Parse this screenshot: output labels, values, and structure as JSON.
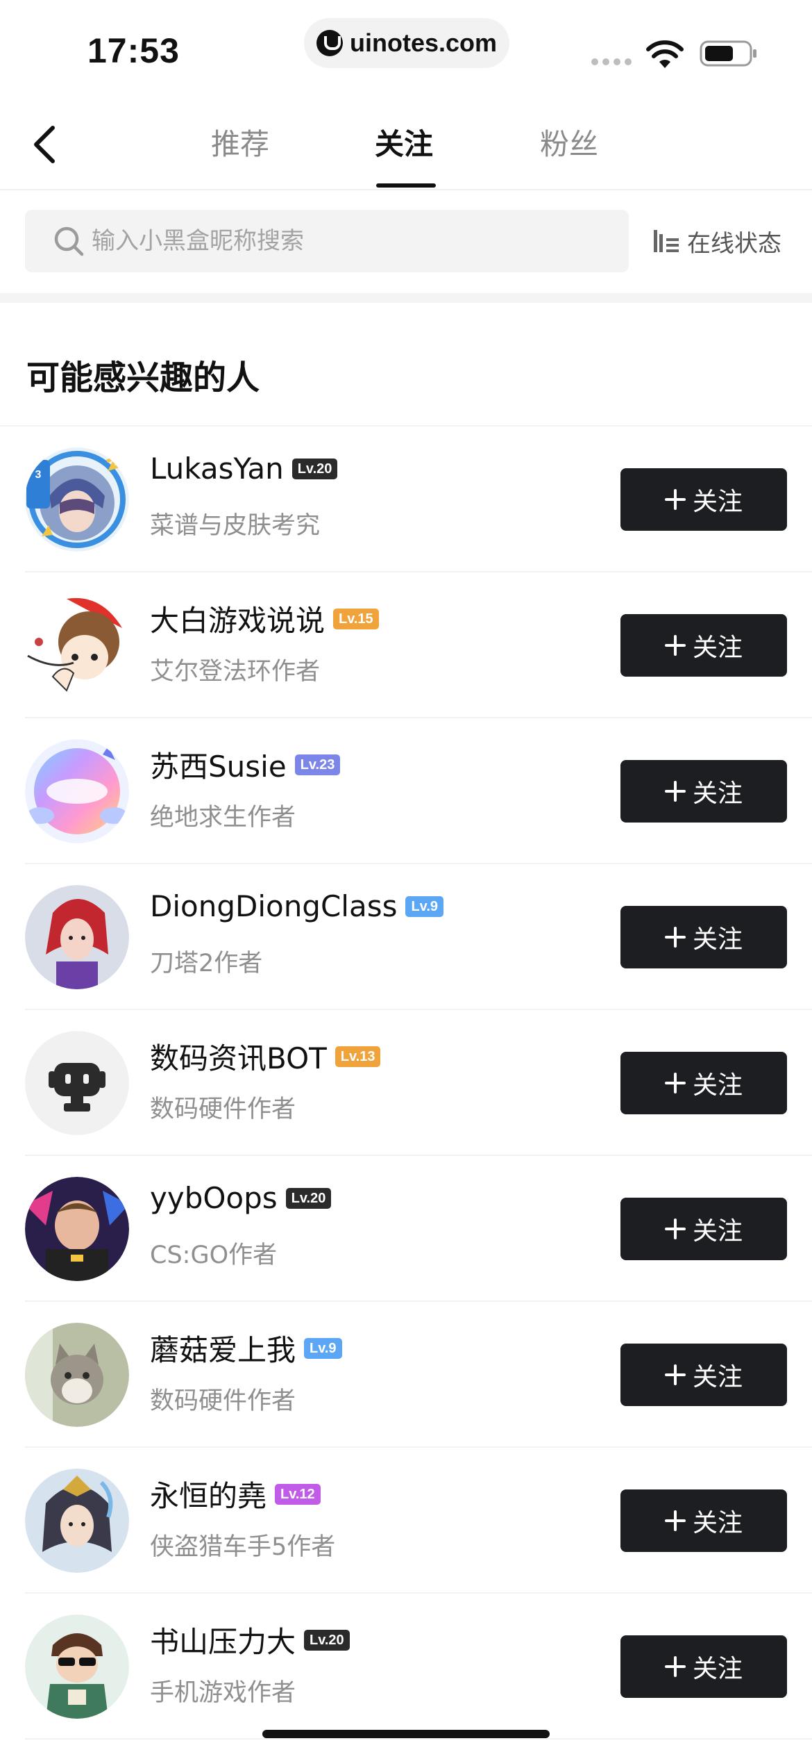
{
  "status_bar": {
    "time": "17:53",
    "url": "uinotes.com"
  },
  "nav": {
    "tabs": [
      {
        "label": "推荐",
        "active": false
      },
      {
        "label": "关注",
        "active": true
      },
      {
        "label": "粉丝",
        "active": false
      }
    ]
  },
  "search": {
    "placeholder": "输入小黑盒昵称搜索",
    "value": "",
    "online_status_label": "在线状态"
  },
  "section": {
    "title": "可能感兴趣的人"
  },
  "follow_label": "关注",
  "users": [
    {
      "name": "LukasYan",
      "level": "Lv.20",
      "level_color": "#2b2b2b",
      "desc": "菜谱与皮肤考究",
      "avatar": "anime-girl-anniversary-avatar"
    },
    {
      "name": "大白游戏说说",
      "level": "Lv.15",
      "level_color": "#f0a23b",
      "desc": "艾尔登法环作者",
      "avatar": "cartoon-boy-avatar"
    },
    {
      "name": "苏西Susie",
      "level": "Lv.23",
      "level_color": "#7b86e8",
      "desc": "绝地求生作者",
      "avatar": "rainbow-sticker-avatar"
    },
    {
      "name": "DiongDiongClass",
      "level": "Lv.9",
      "level_color": "#5ba7f5",
      "desc": "刀塔2作者",
      "avatar": "red-hair-hero-avatar"
    },
    {
      "name": "数码资讯BOT",
      "level": "Lv.13",
      "level_color": "#f0a23b",
      "desc": "数码硬件作者",
      "avatar": "robot-avatar"
    },
    {
      "name": "yybOops",
      "level": "Lv.20",
      "level_color": "#2b2b2b",
      "desc": "CS:GO作者",
      "avatar": "gamer-photo-avatar"
    },
    {
      "name": "蘑菇爱上我",
      "level": "Lv.9",
      "level_color": "#5ba7f5",
      "desc": "数码硬件作者",
      "avatar": "cat-photo-avatar"
    },
    {
      "name": "永恒的堯",
      "level": "Lv.12",
      "level_color": "#c05ce8",
      "desc": "侠盗猎车手5作者",
      "avatar": "anime-warrior-avatar"
    },
    {
      "name": "书山压力大",
      "level": "Lv.20",
      "level_color": "#2b2b2b",
      "desc": "手机游戏作者",
      "avatar": "sunglasses-cartoon-avatar"
    }
  ]
}
